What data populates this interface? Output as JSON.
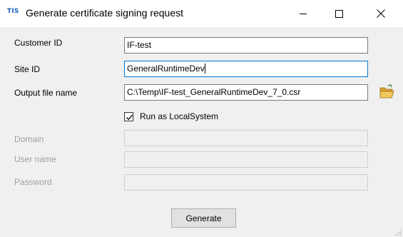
{
  "window": {
    "app_logo": "TIS",
    "title": "Generate certificate signing request",
    "controls": {
      "minimize_icon": "minimize-icon",
      "maximize_icon": "maximize-icon",
      "close_icon": "close-icon"
    }
  },
  "form": {
    "customer_id": {
      "label": "Customer ID",
      "value": "IF-test"
    },
    "site_id": {
      "label": "Site ID",
      "value": "GeneralRuntimeDev"
    },
    "output_file": {
      "label": "Output file name",
      "value": "C:\\Temp\\IF-test_GeneralRuntimeDev_7_0.csr",
      "browse_icon": "folder-open-icon"
    },
    "run_as_localsystem": {
      "label": "Run as LocalSystem",
      "checked": true
    },
    "domain": {
      "label": "Domain",
      "value": "",
      "enabled": false
    },
    "user_name": {
      "label": "User name",
      "value": "",
      "enabled": false
    },
    "password": {
      "label": "Password",
      "value": "",
      "enabled": false
    }
  },
  "actions": {
    "generate_label": "Generate"
  },
  "colors": {
    "focus_border": "#0078d7",
    "disabled_text": "#a0a0a0",
    "logo": "#1a5fb4",
    "folder": "#e8b84a"
  }
}
